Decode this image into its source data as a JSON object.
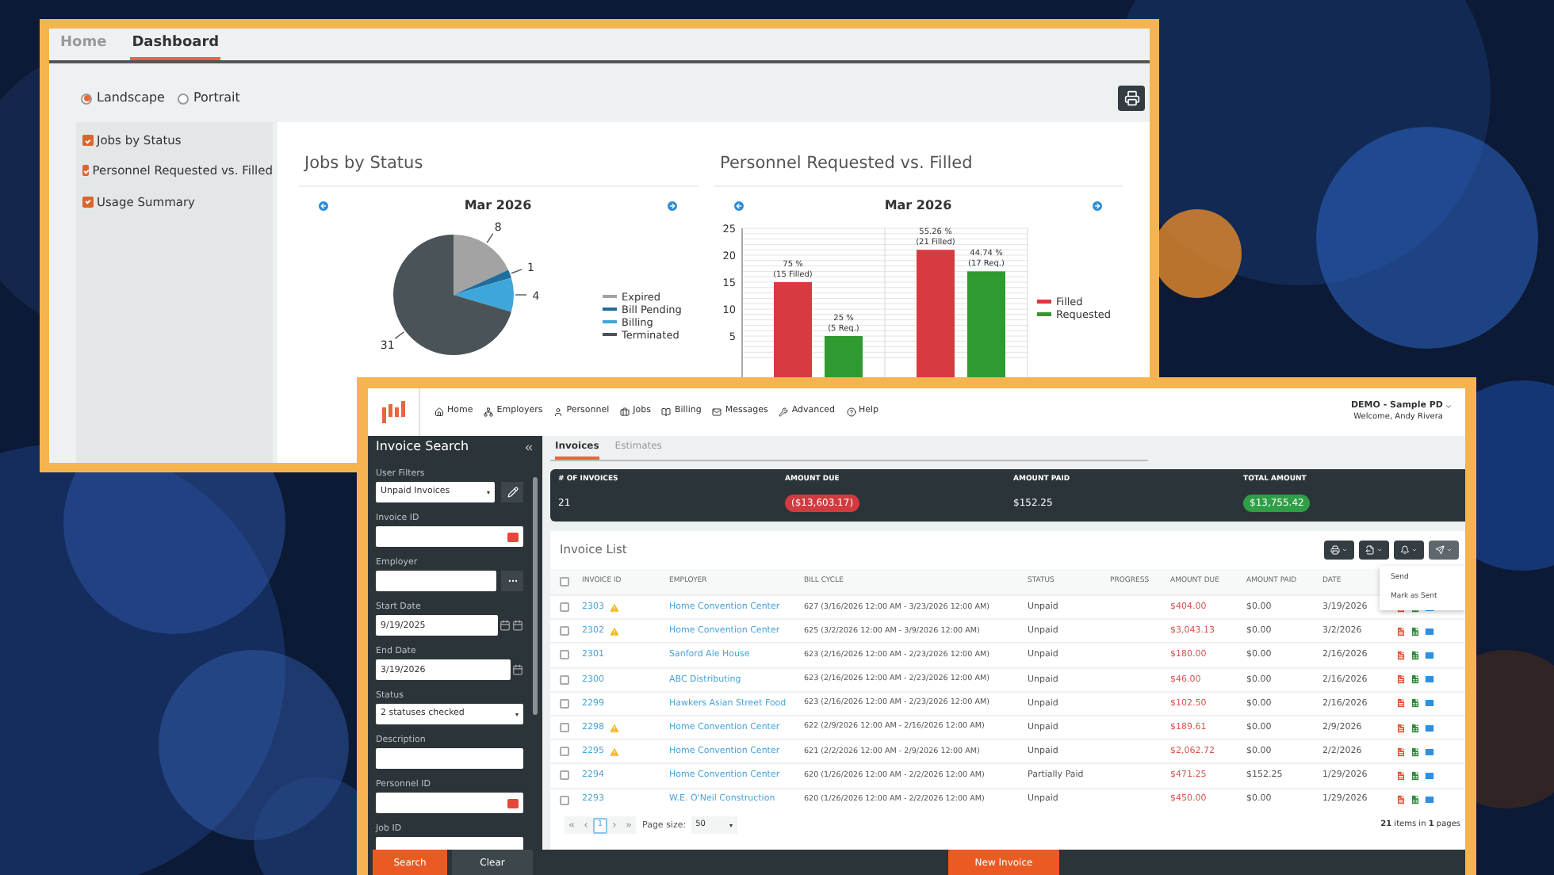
{
  "dashboard_window": {
    "tabs": [
      {
        "label": "Home",
        "selected": false
      },
      {
        "label": "Dashboard",
        "selected": true
      }
    ],
    "orientation_options": [
      {
        "label": "Landscape",
        "selected": true
      },
      {
        "label": "Portrait",
        "selected": false
      }
    ],
    "widget_options": [
      {
        "label": "Jobs by Status",
        "checked": true
      },
      {
        "label": "Personnel Requested vs. Filled",
        "checked": true
      },
      {
        "label": "Usage Summary",
        "checked": true
      }
    ],
    "widgets": [
      {
        "title": "Jobs by Status",
        "period": "Mar 2026",
        "chart_data": {
          "type": "pie",
          "categories": [
            "Expired",
            "Bill Pending",
            "Billing",
            "Terminated"
          ],
          "values": [
            8,
            1,
            4,
            31
          ],
          "colors": [
            "#a3a3a3",
            "#1f6e9c",
            "#3fa6dc",
            "#4a5358"
          ],
          "data_labels": true,
          "legend": true
        }
      },
      {
        "title": "Personnel Requested vs. Filled",
        "period": "Mar 2026",
        "chart_data": {
          "type": "bar",
          "ylim": [
            0,
            25
          ],
          "grid": true,
          "legend": true,
          "yticks": [
            5,
            10,
            15,
            20,
            25
          ],
          "series": [
            {
              "name": "Filled",
              "color": "#d93a3f",
              "values": [
                15,
                21
              ]
            },
            {
              "name": "Requested",
              "color": "#2f9a30",
              "values": [
                5,
                17
              ]
            }
          ],
          "value_labels": [
            [
              [
                "75 %",
                "(15 Filled)"
              ],
              [
                "55.26 %",
                "(21 Filled)"
              ]
            ],
            [
              [
                "25 %",
                "(5 Req.)"
              ],
              [
                "44.74 %",
                "(17 Req.)"
              ]
            ]
          ]
        }
      }
    ]
  },
  "invoice_window": {
    "nav": [
      {
        "label": "Home"
      },
      {
        "label": "Employers"
      },
      {
        "label": "Personnel"
      },
      {
        "label": "Jobs"
      },
      {
        "label": "Billing"
      },
      {
        "label": "Messages"
      },
      {
        "label": "Advanced"
      },
      {
        "label": "Help"
      }
    ],
    "account": {
      "name": "DEMO - Sample PD",
      "welcome": "Welcome, Andy Rivera"
    },
    "sidebar": {
      "title": "Invoice Search",
      "fields": [
        {
          "label": "User Filters",
          "kind": "select-edit",
          "value": "Unpaid Invoices"
        },
        {
          "label": "Invoice ID",
          "kind": "input-clear"
        },
        {
          "label": "Employer",
          "kind": "input-lookup"
        },
        {
          "label": "Start Date",
          "kind": "date-double",
          "value": "9/19/2025"
        },
        {
          "label": "End Date",
          "kind": "date",
          "value": "3/19/2026"
        },
        {
          "label": "Status",
          "kind": "select",
          "value": "2 statuses checked"
        },
        {
          "label": "Description",
          "kind": "input"
        },
        {
          "label": "Personnel ID",
          "kind": "input-clear"
        },
        {
          "label": "Job ID",
          "kind": "input"
        }
      ],
      "search_button": "Search",
      "clear_button": "Clear"
    },
    "tabs": [
      {
        "label": "Invoices",
        "selected": true
      },
      {
        "label": "Estimates",
        "selected": false
      }
    ],
    "summary": {
      "columns": [
        "# OF INVOICES",
        "AMOUNT DUE",
        "AMOUNT PAID",
        "TOTAL AMOUNT"
      ],
      "values": [
        {
          "text": "21",
          "kind": "plain"
        },
        {
          "text": "($13,603.17)",
          "kind": "negative"
        },
        {
          "text": "$152.25",
          "kind": "plain"
        },
        {
          "text": "$13,755.42",
          "kind": "positive"
        }
      ]
    },
    "invoice_list": {
      "title": "Invoice List",
      "menu": [
        "Send",
        "Mark as Sent"
      ],
      "select_all_checked": false,
      "columns": [
        "INVOICE ID",
        "EMPLOYER",
        "BILL CYCLE",
        "STATUS",
        "PROGRESS",
        "AMOUNT DUE",
        "AMOUNT PAID",
        "DATE"
      ],
      "rows": [
        {
          "checked": false,
          "invoice_id": "2303",
          "warning": true,
          "employer": "Home Convention Center",
          "bill_cycle": "627 (3/16/2026 12:00 AM - 3/23/2026 12:00 AM)",
          "status": "Unpaid",
          "amount_due": "$404.00",
          "amount_paid": "$0.00",
          "date": "3/19/2026"
        },
        {
          "checked": false,
          "invoice_id": "2302",
          "warning": true,
          "employer": "Home Convention Center",
          "bill_cycle": "625 (3/2/2026 12:00 AM - 3/9/2026 12:00 AM)",
          "status": "Unpaid",
          "amount_due": "$3,043.13",
          "amount_paid": "$0.00",
          "date": "3/2/2026"
        },
        {
          "checked": false,
          "invoice_id": "2301",
          "warning": false,
          "employer": "Sanford Ale House",
          "bill_cycle": "623 (2/16/2026 12:00 AM - 2/23/2026 12:00 AM)",
          "status": "Unpaid",
          "amount_due": "$180.00",
          "amount_paid": "$0.00",
          "date": "2/16/2026"
        },
        {
          "checked": false,
          "invoice_id": "2300",
          "warning": false,
          "employer": "ABC Distributing",
          "bill_cycle": "623 (2/16/2026 12:00 AM - 2/23/2026 12:00 AM)",
          "status": "Unpaid",
          "amount_due": "$46.00",
          "amount_paid": "$0.00",
          "date": "2/16/2026"
        },
        {
          "checked": false,
          "invoice_id": "2299",
          "warning": false,
          "employer": "Hawkers Asian Street Food",
          "bill_cycle": "623 (2/16/2026 12:00 AM - 2/23/2026 12:00 AM)",
          "status": "Unpaid",
          "amount_due": "$102.50",
          "amount_paid": "$0.00",
          "date": "2/16/2026"
        },
        {
          "checked": false,
          "invoice_id": "2298",
          "warning": true,
          "employer": "Home Convention Center",
          "bill_cycle": "622 (2/9/2026 12:00 AM - 2/16/2026 12:00 AM)",
          "status": "Unpaid",
          "amount_due": "$189.61",
          "amount_paid": "$0.00",
          "date": "2/9/2026"
        },
        {
          "checked": false,
          "invoice_id": "2295",
          "warning": true,
          "employer": "Home Convention Center",
          "bill_cycle": "621 (2/2/2026 12:00 AM - 2/9/2026 12:00 AM)",
          "status": "Unpaid",
          "amount_due": "$2,062.72",
          "amount_paid": "$0.00",
          "date": "2/2/2026"
        },
        {
          "checked": false,
          "invoice_id": "2294",
          "warning": false,
          "employer": "Home Convention Center",
          "bill_cycle": "620 (1/26/2026 12:00 AM - 2/2/2026 12:00 AM)",
          "status": "Partially Paid",
          "amount_due": "$471.25",
          "amount_paid": "$152.25",
          "date": "1/29/2026"
        },
        {
          "checked": false,
          "invoice_id": "2293",
          "warning": false,
          "employer": "W.E. O'Neil Construction",
          "bill_cycle": "620 (1/26/2026 12:00 AM - 2/2/2026 12:00 AM)",
          "status": "Unpaid",
          "amount_due": "$450.00",
          "amount_paid": "$0.00",
          "date": "1/29/2026"
        }
      ],
      "pagination": {
        "current_page": "1",
        "page_size_label": "Page size:",
        "page_size": "50",
        "summary": "**21** items in **1** pages"
      }
    },
    "new_button": "New Invoice"
  }
}
